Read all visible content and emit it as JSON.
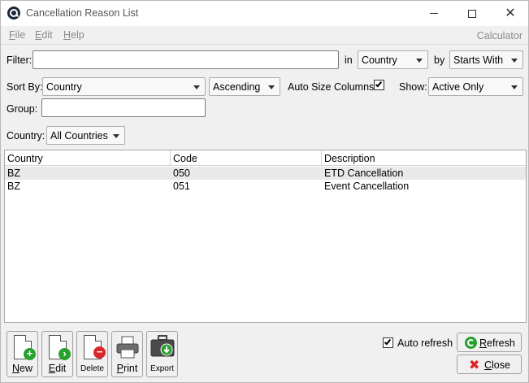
{
  "window": {
    "title": "Cancellation Reason List"
  },
  "menu": {
    "file_u": "F",
    "file_rest": "ile",
    "edit_u": "E",
    "edit_rest": "dit",
    "help_u": "H",
    "help_rest": "elp",
    "calculator": "Calculator"
  },
  "filter": {
    "label": "Filter:",
    "value": "",
    "in_label": "in",
    "field": "Country",
    "by_label": "by",
    "match": "Starts With"
  },
  "sort": {
    "label": "Sort By:",
    "field": "Country",
    "order": "Ascending",
    "auto_size_label": "Auto Size Columns",
    "auto_size_checked": true,
    "show_label": "Show:",
    "show_value": "Active Only"
  },
  "group": {
    "label": "Group:",
    "value": ""
  },
  "country": {
    "label": "Country:",
    "value": "All Countries"
  },
  "table": {
    "columns": [
      "Country",
      "Code",
      "Description"
    ],
    "rows": [
      {
        "country": "BZ",
        "code": "050",
        "description": "ETD Cancellation"
      },
      {
        "country": "BZ",
        "code": "051",
        "description": "Event Cancellation"
      }
    ]
  },
  "toolbar": {
    "new_u": "N",
    "new_rest": "ew",
    "edit_u": "E",
    "edit_rest": "dit",
    "delete": "Delete",
    "print_u": "P",
    "print_rest": "rint",
    "export": "Export"
  },
  "footer": {
    "auto_refresh_label": "Auto refresh",
    "auto_refresh_checked": true,
    "refresh_u": "R",
    "refresh_rest": "efresh",
    "close_u": "C",
    "close_rest": "lose"
  },
  "colors": {
    "accent_green": "#27a02e",
    "accent_red": "#d8262a"
  }
}
